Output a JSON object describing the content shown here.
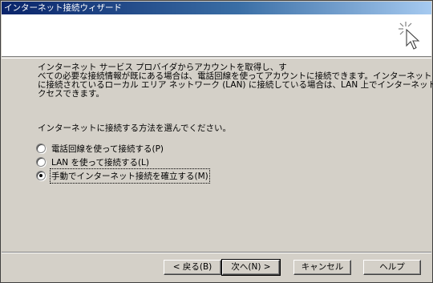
{
  "window": {
    "title": "インターネット接続ウィザード"
  },
  "intro": {
    "lines": [
      "インターネット サービス プロバイダからアカウントを取得し、す",
      "べての必要な接続情報が既にある場合は、電話回線を使ってアカウントに接続できます。インターネット",
      "に接続されているローカル エリア ネットワーク (LAN) に接続している場合は、LAN 上でインターネットにア",
      "クセスできます。"
    ]
  },
  "prompt": "インターネットに接続する方法を選んでください。",
  "options": [
    {
      "label": "電話回線を使って接続する(P)",
      "checked": false
    },
    {
      "label": "LAN を使って接続する(L)",
      "checked": false
    },
    {
      "label": "手動でインターネット接続を確立する(M)",
      "checked": true
    }
  ],
  "buttons": {
    "back": "< 戻る(B)",
    "next": "次へ(N) >",
    "cancel": "キャンセル",
    "help": "ヘルプ"
  },
  "icons": {
    "header_logo": "wizard-sparkle-cursor-icon"
  }
}
